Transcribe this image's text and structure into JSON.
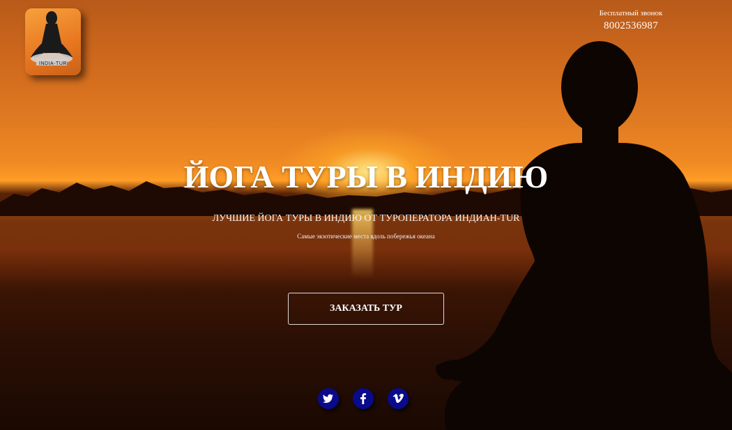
{
  "logo": {
    "text": "INDIA-TUR",
    "icon": "meditating-figure-icon"
  },
  "contact": {
    "label": "Бесплатный звонок",
    "phone": "8002536987"
  },
  "hero": {
    "title": "ЙОГА ТУРЫ В ИНДИЮ",
    "subtitle": "ЛУЧШИЕ ЙОГА ТУРЫ В ИНДИЮ ОТ ТУРОПЕРАТОРА ИНДИАН-TUR",
    "tagline": "Самые экзотические места вдоль побережья океана",
    "cta_label": "ЗАКАЗАТЬ ТУР"
  },
  "social": [
    {
      "name": "Twitter",
      "icon": "twitter-icon"
    },
    {
      "name": "Facebook",
      "icon": "facebook-icon"
    },
    {
      "name": "Vimeo",
      "icon": "vimeo-icon"
    }
  ],
  "colors": {
    "social_bg": "#0a0a8c",
    "sky_top": "#b85a1a",
    "sun": "#ffe08a",
    "text": "#ffffff"
  }
}
